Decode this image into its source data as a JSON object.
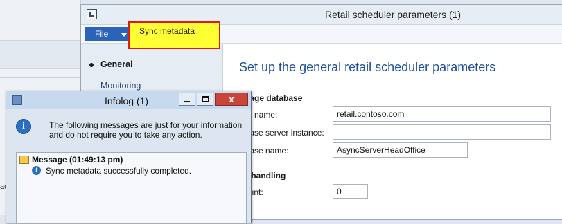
{
  "main_window": {
    "title": "Retail scheduler parameters (1)",
    "file_label": "File",
    "sync_tab_label": "Sync metadata",
    "nav": [
      {
        "label": "General",
        "active": true
      },
      {
        "label": "Monitoring",
        "active": false
      }
    ],
    "content_title": "Set up the general retail scheduler parameters",
    "sections": {
      "message_db": "ssage database",
      "error_handling": "or handling"
    },
    "fields": {
      "server_name": {
        "label": "ver name:",
        "value": "retail.contoso.com"
      },
      "db_instance": {
        "label": "abase server instance:",
        "value": ""
      },
      "db_name": {
        "label": "abase name:",
        "value": "AsyncServerHeadOffice"
      },
      "retry_count": {
        "label": "count:",
        "value": "0"
      }
    },
    "bg_fragment": "ac"
  },
  "infolog": {
    "title": "Infolog (1)",
    "close_glyph": "x",
    "intro": "The following messages are just for your information and do not require you to take any action.",
    "tree": {
      "root_label": "Message (01:49:13 pm)",
      "message": "Sync metadata successfully completed."
    }
  },
  "colors": {
    "accent_blue": "#2b63b8",
    "highlight_yellow": "#ffff33",
    "highlight_border": "#e01818",
    "close_red": "#c8453a"
  },
  "icons": [
    "app-icon",
    "chevron-down-icon",
    "infolog-icon",
    "minimize-icon",
    "maximize-icon",
    "close-icon",
    "info-icon",
    "message-folder-icon"
  ]
}
